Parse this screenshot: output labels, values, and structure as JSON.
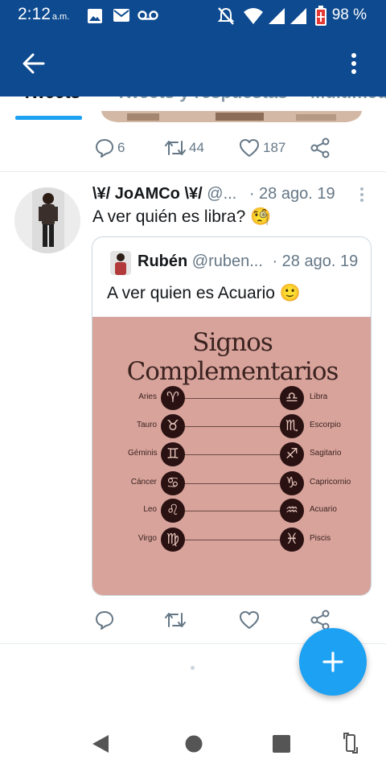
{
  "status_bar": {
    "time": "2:12",
    "ampm": "a.m.",
    "battery_percent": "98 %",
    "icons": [
      "image-icon",
      "mail-icon",
      "voicemail-icon",
      "mute-icon",
      "wifi-icon",
      "signal-icon",
      "signal-icon",
      "battery-icon"
    ]
  },
  "app_bar": {
    "back_icon": "arrow-left-icon",
    "menu_icon": "more-vertical-icon"
  },
  "tabs": [
    {
      "label": "Tweets",
      "active": true
    },
    {
      "label": "Tweets y respuestas",
      "active": false
    },
    {
      "label": "Multimedia",
      "active": false
    }
  ],
  "previous_tweet": {
    "actions": {
      "replies": "6",
      "retweets": "44",
      "likes": "187"
    }
  },
  "tweet": {
    "author_name": "\\¥/ JoAMCo \\¥/",
    "author_handle": "@...",
    "date": "· 28 ago. 19",
    "text": "A ver quién es libra? 🧐",
    "quote": {
      "author_name": "Rubén",
      "author_handle": "@ruben...",
      "date": "· 28 ago. 19",
      "text": "A ver quien es Acuario 🙂",
      "image": {
        "title": "Signos Complementarios",
        "pairs": [
          {
            "left": "Aries",
            "left_symbol": "♈",
            "right": "Libra",
            "right_symbol": "♎"
          },
          {
            "left": "Tauro",
            "left_symbol": "♉",
            "right": "Escorpio",
            "right_symbol": "♏"
          },
          {
            "left": "Géminis",
            "left_symbol": "♊",
            "right": "Sagitario",
            "right_symbol": "♐"
          },
          {
            "left": "Cáncer",
            "left_symbol": "♋",
            "right": "Capricornio",
            "right_symbol": "♑"
          },
          {
            "left": "Leo",
            "left_symbol": "♌",
            "right": "Acuario",
            "right_symbol": "♒"
          },
          {
            "left": "Virgo",
            "left_symbol": "♍",
            "right": "Piscis",
            "right_symbol": "♓"
          }
        ]
      }
    }
  },
  "colors": {
    "brand": "#0d4a8f",
    "accent": "#1da1f2",
    "muted": "#657786"
  }
}
